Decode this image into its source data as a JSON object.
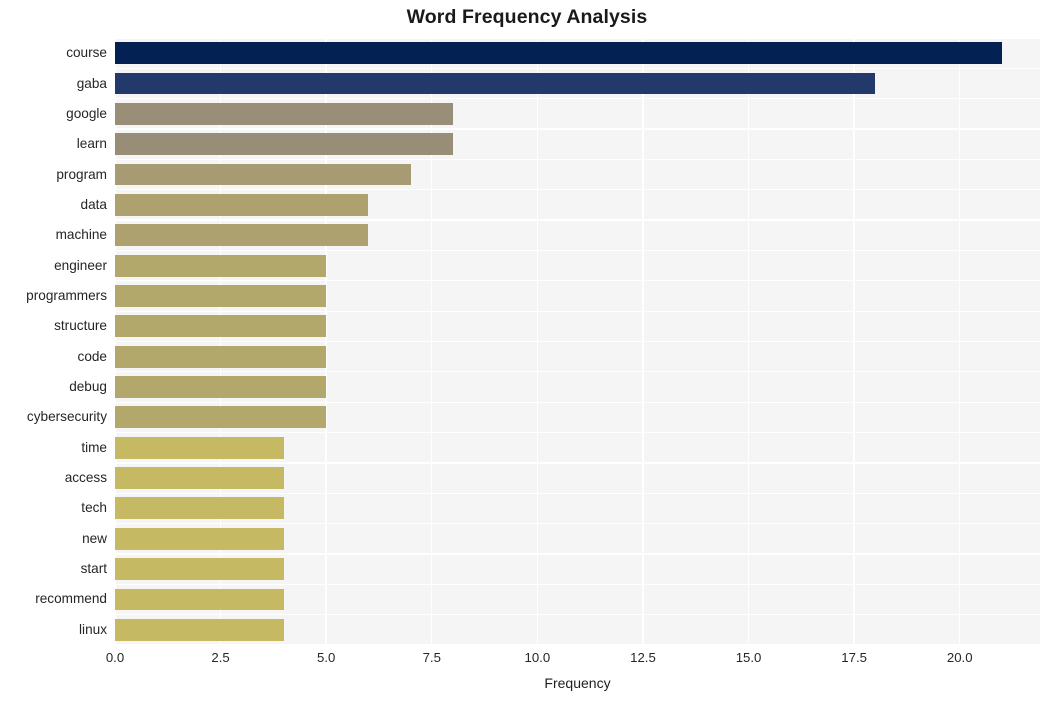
{
  "chart_data": {
    "type": "bar",
    "orientation": "horizontal",
    "title": "Word Frequency Analysis",
    "xlabel": "Frequency",
    "ylabel": "",
    "categories": [
      "course",
      "gaba",
      "google",
      "learn",
      "program",
      "data",
      "machine",
      "engineer",
      "programmers",
      "structure",
      "code",
      "debug",
      "cybersecurity",
      "time",
      "access",
      "tech",
      "new",
      "start",
      "recommend",
      "linux"
    ],
    "values": [
      21,
      18,
      8,
      8,
      7,
      6,
      6,
      5,
      5,
      5,
      5,
      5,
      5,
      4,
      4,
      4,
      4,
      4,
      4,
      4
    ],
    "bar_colors": [
      "#032153",
      "#24396b",
      "#998f78",
      "#988e77",
      "#a69b72",
      "#ad a2 6f",
      "#aca16f",
      "#b3a86c",
      "#b3a86c",
      "#b3a86c",
      "#b3a86c",
      "#b3a86c",
      "#b3a86c",
      "#c6b964",
      "#c6b964",
      "#c6b964",
      "#c6b964",
      "#c6b964",
      "#c6b964",
      "#c6b964"
    ],
    "xticks": [
      "0.0",
      "2.5",
      "5.0",
      "7.5",
      "10.0",
      "12.5",
      "15.0",
      "17.5",
      "20.0"
    ],
    "xtick_values": [
      0,
      2.5,
      5,
      7.5,
      10,
      12.5,
      15,
      17.5,
      20
    ],
    "xlim": [
      0,
      21.9
    ],
    "grid": true,
    "legend": "none",
    "plot_background": "#f5f5f6",
    "figure_background": "#ffffff",
    "grid_color": "#ffffff",
    "text_color": "#262626"
  }
}
